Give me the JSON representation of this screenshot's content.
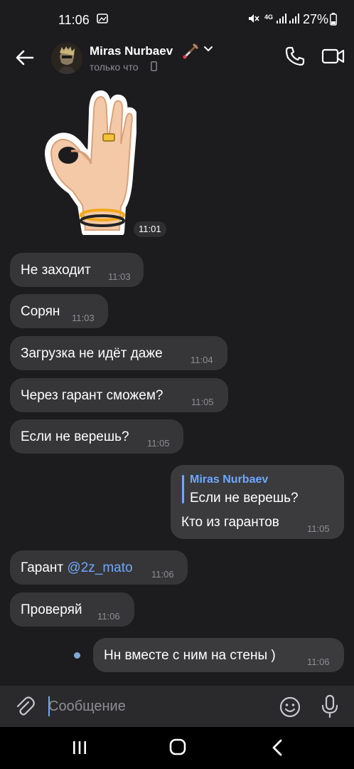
{
  "status_bar": {
    "time": "11:06",
    "battery": "27%",
    "network": "4G"
  },
  "header": {
    "contact_name": "Miras Nurbaev",
    "status": "только что",
    "icons": [
      "back-arrow-icon",
      "phone-call-icon",
      "video-call-icon"
    ]
  },
  "sticker": {
    "description_icon": "ok-hand-sticker",
    "time": "11:01"
  },
  "messages": [
    {
      "text": "Не заходит",
      "time": "11:03"
    },
    {
      "text": "Сорян",
      "time": "11:03"
    },
    {
      "text": "Загрузка не идёт даже",
      "time": "11:04"
    },
    {
      "text": "Через гарант сможем?",
      "time": "11:05"
    },
    {
      "text": "Если не верешь?",
      "time": "11:05"
    }
  ],
  "outgoing_reply": {
    "reply_author": "Miras Nurbaev",
    "reply_text": "Если не верешь?",
    "text": "Кто из гарантов",
    "time": "11:05"
  },
  "messages2": [
    {
      "text_prefix": "Гарант ",
      "mention": "@2z_mato",
      "time": "11:06"
    },
    {
      "text": "Проверяй",
      "time": "11:06"
    }
  ],
  "outgoing_last": {
    "text": "Нн вместе с ним на стены )",
    "time": "11:06"
  },
  "composer": {
    "placeholder": "Сообщение"
  },
  "colors": {
    "background": "#1c1c1e",
    "bubble": "#363638",
    "accent": "#6fa8ff",
    "muted": "#8e8e93"
  }
}
